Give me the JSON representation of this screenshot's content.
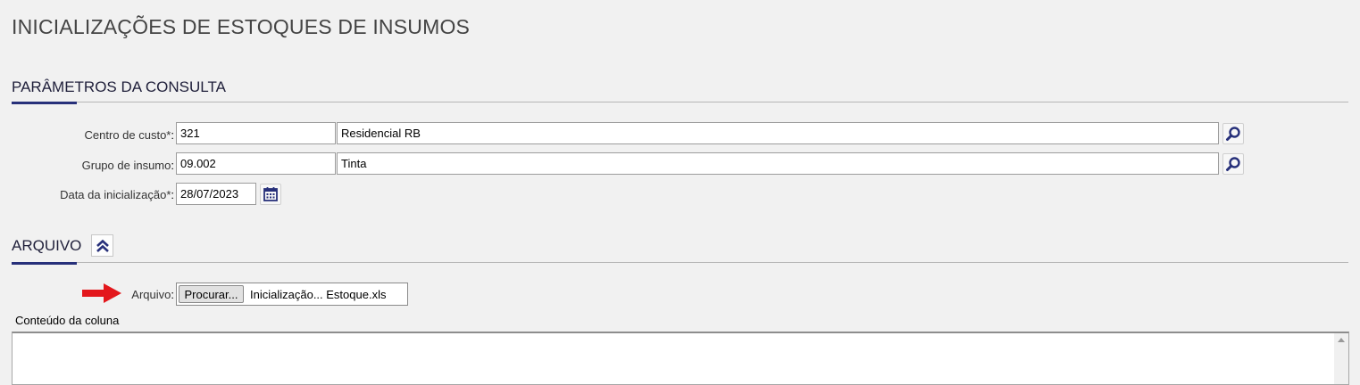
{
  "page": {
    "title": "INICIALIZAÇÕES DE ESTOQUES DE INSUMOS"
  },
  "params_section": {
    "title": "PARÂMETROS DA CONSULTA",
    "centro_custo": {
      "label": "Centro de custo*",
      "code": "321",
      "description": "Residencial RB",
      "lookup_icon": "search-icon"
    },
    "grupo_insumo": {
      "label": "Grupo de insumo",
      "code": "09.002",
      "description": "Tinta",
      "lookup_icon": "search-icon"
    },
    "data_inicializacao": {
      "label": "Data da inicialização*",
      "value": "28/07/2023",
      "icon": "calendar-icon"
    }
  },
  "arquivo_section": {
    "title": "ARQUIVO",
    "collapse_icon": "double-chevron-up-icon",
    "arquivo": {
      "label": "Arquivo",
      "browse_label": "Procurar...",
      "file_name": "Inicialização... Estoque.xls"
    },
    "conteudo": {
      "label": "Conteúdo da coluna",
      "value": ""
    }
  },
  "colors": {
    "accent": "#27307a",
    "annotation_arrow": "#e3171c",
    "background": "#f1f1f1"
  }
}
